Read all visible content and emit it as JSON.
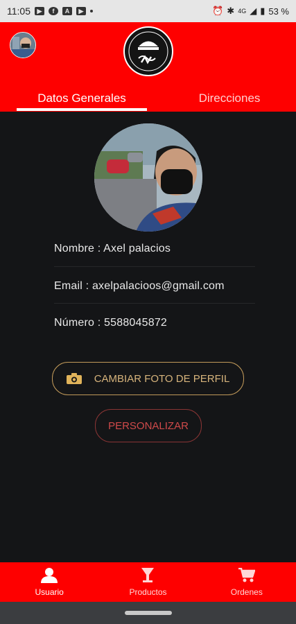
{
  "status_bar": {
    "time": "11:05",
    "network": "4G",
    "battery": "53 %"
  },
  "header": {
    "tabs": [
      {
        "label": "Datos Generales",
        "active": true
      },
      {
        "label": "Direcciones",
        "active": false
      }
    ],
    "brand_color": "#fe0000"
  },
  "profile": {
    "nombre_line": "Nombre : Axel palacios",
    "email_line": "Email : axelpalacioos@gmail.com",
    "numero_line": "Número : 5588045872"
  },
  "buttons": {
    "change_photo": "CAMBIAR FOTO DE PERFIL",
    "personalize": "PERSONALIZAR"
  },
  "bottom_nav": {
    "items": [
      {
        "label": "Usuario",
        "icon": "user-icon",
        "active": true
      },
      {
        "label": "Productos",
        "icon": "glass-icon",
        "active": false
      },
      {
        "label": "Ordenes",
        "icon": "cart-icon",
        "active": false
      }
    ]
  }
}
